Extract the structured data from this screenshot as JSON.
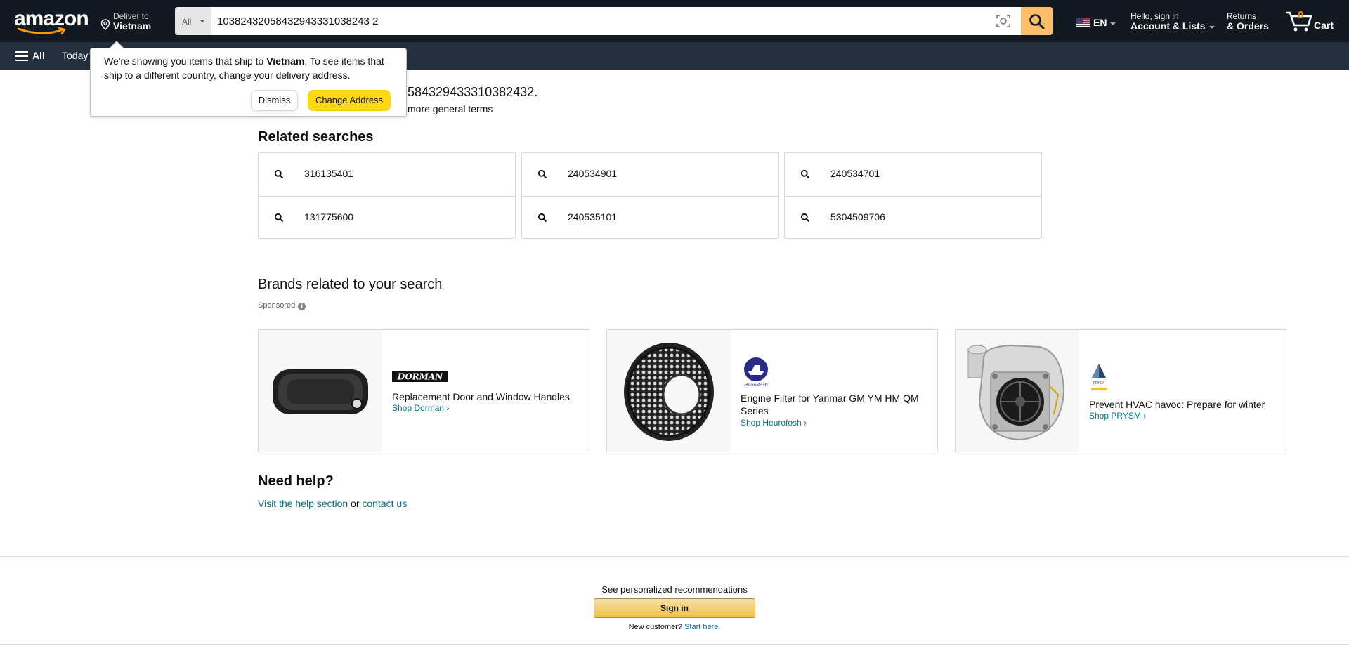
{
  "header": {
    "logo_text": "amazon",
    "deliver_line1": "Deliver to",
    "deliver_line2": "Vietnam",
    "search_category": "All",
    "search_value": "10382432058432943331038243 2",
    "language": "EN",
    "account_line1": "Hello, sign in",
    "account_line2": "Account & Lists",
    "returns_line1": "Returns",
    "returns_line2": "& Orders",
    "cart_count": "0",
    "cart_label": "Cart",
    "accent_color": "#febd69"
  },
  "subnav": {
    "all_label": "All",
    "link1": "Today's"
  },
  "popover": {
    "text_before": "We're showing you items that ship to ",
    "country": "Vietnam",
    "text_after": ". To see items that ship to a different country, change your delivery address.",
    "dismiss_label": "Dismiss",
    "change_label": "Change Address"
  },
  "results": {
    "line1": "584329433310382432.",
    "line2": "more general terms"
  },
  "related": {
    "title": "Related searches",
    "items": [
      "316135401",
      "131775600",
      "240534901",
      "240535101",
      "240534701",
      "5304509706"
    ]
  },
  "brands": {
    "title": "Brands related to your search",
    "sponsored": "Sponsored",
    "cards": [
      {
        "logo": "DORMAN",
        "headline": "Replacement Door and Window Handles",
        "link": "Shop Dorman"
      },
      {
        "logo": "Heurofosh",
        "headline": "Engine Filter for Yanmar GM YM HM QM Series",
        "link": "Shop Heurofosh"
      },
      {
        "logo": "PRYSM",
        "headline": "Prevent HVAC havoc: Prepare for winter",
        "link": "Shop PRYSM"
      }
    ]
  },
  "help": {
    "title": "Need help?",
    "link1": "Visit the help section",
    "or": "or",
    "link2": "contact us"
  },
  "signin": {
    "see": "See personalized recommendations",
    "button": "Sign in",
    "new_customer": "New customer?",
    "start_here": "Start here."
  }
}
